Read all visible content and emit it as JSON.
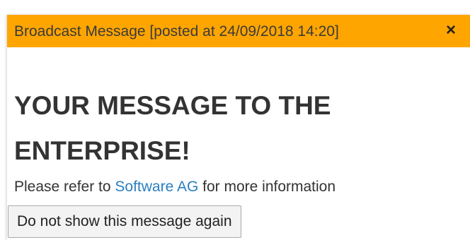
{
  "dialog": {
    "title": "Broadcast Message [posted at 24/09/2018 14:20]",
    "close_symbol": "×",
    "heading": "YOUR MESSAGE TO THE ENTERPRISE!",
    "info_prefix": "Please refer to ",
    "info_link": "Software AG",
    "info_suffix": " for more information",
    "dismiss_label": "Do not show this message again"
  },
  "colors": {
    "titlebar": "#FFA500",
    "link": "#2a7fc0",
    "text": "#333333"
  },
  "icons": {
    "close": "close-icon"
  }
}
